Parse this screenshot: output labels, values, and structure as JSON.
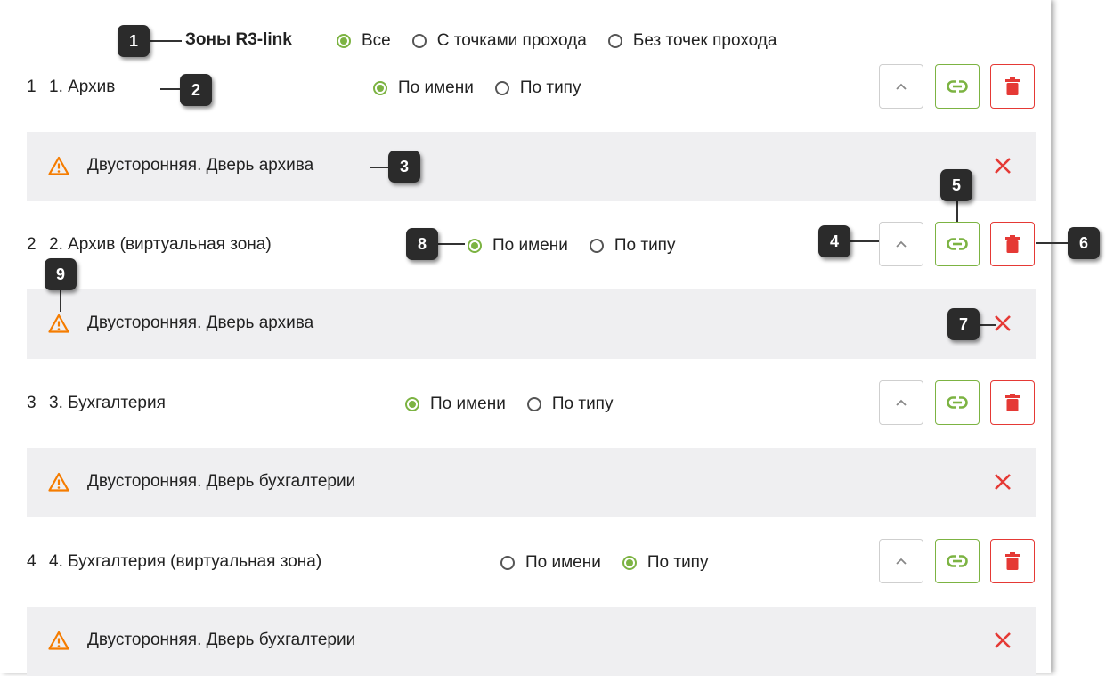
{
  "header": {
    "title": "Зоны R3-link",
    "filters": [
      {
        "label": "Все",
        "checked": true
      },
      {
        "label": "С точками прохода",
        "checked": false
      },
      {
        "label": "Без точек прохода",
        "checked": false
      }
    ]
  },
  "zones": [
    {
      "index": "1",
      "name": "1. Архив",
      "sort": [
        {
          "label": "По имени",
          "checked": true
        },
        {
          "label": "По типу",
          "checked": false
        }
      ],
      "door": "Двусторонняя. Дверь архива"
    },
    {
      "index": "2",
      "name": "2. Архив (виртуальная зона)",
      "sort": [
        {
          "label": "По имени",
          "checked": true
        },
        {
          "label": "По типу",
          "checked": false
        }
      ],
      "door": "Двусторонняя. Дверь архива"
    },
    {
      "index": "3",
      "name": "3. Бухгалтерия",
      "sort": [
        {
          "label": "По имени",
          "checked": true
        },
        {
          "label": "По типу",
          "checked": false
        }
      ],
      "door": "Двусторонняя. Дверь бухгалтерии"
    },
    {
      "index": "4",
      "name": "4. Бухгалтерия (виртуальная зона)",
      "sort": [
        {
          "label": "По имени",
          "checked": false
        },
        {
          "label": "По типу",
          "checked": true
        }
      ],
      "door": "Двусторонняя. Дверь бухгалтерии"
    }
  ],
  "callouts": [
    "1",
    "2",
    "3",
    "4",
    "5",
    "6",
    "7",
    "8",
    "9"
  ],
  "colors": {
    "accent_green": "#7cb342",
    "danger_red": "#e53935",
    "warning_orange": "#f57c00",
    "row_bg": "#efeff1",
    "callout_bg": "#2b2b2b"
  },
  "icons": [
    "chevron-up-icon",
    "link-icon",
    "trash-icon",
    "warning-icon",
    "close-icon"
  ]
}
